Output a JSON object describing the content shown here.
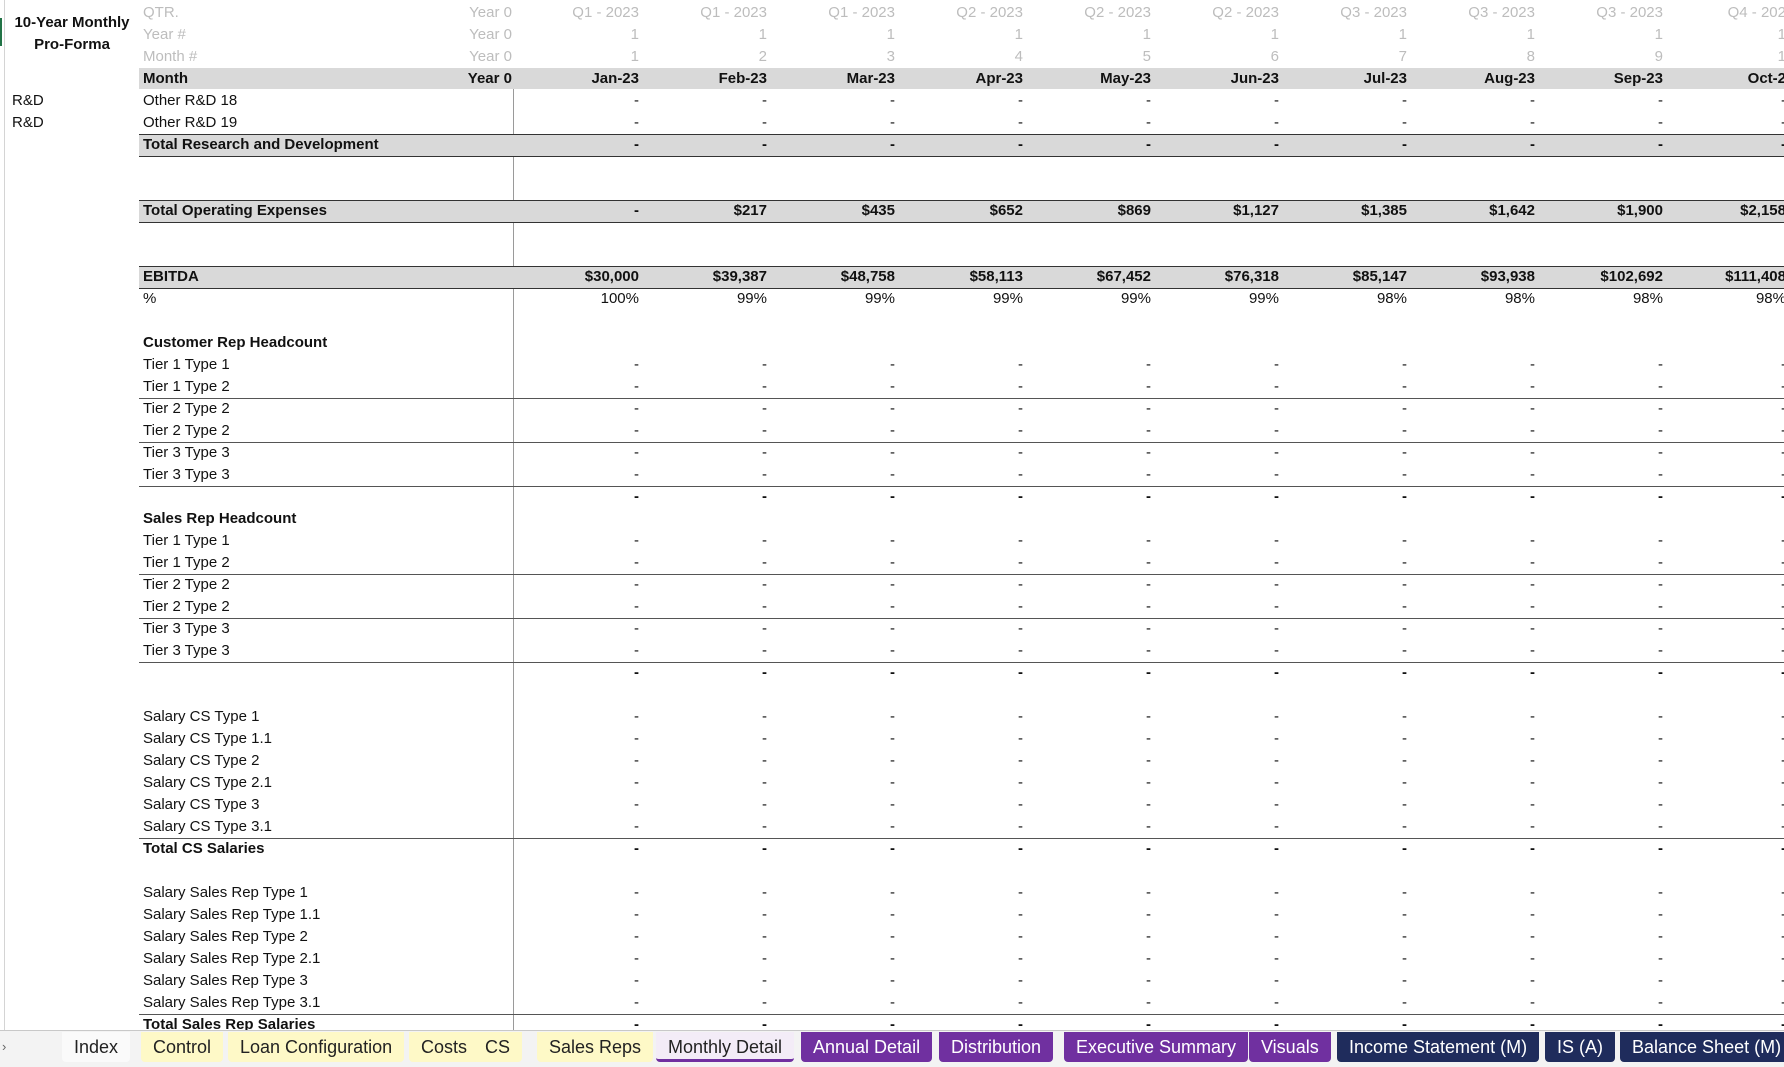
{
  "title_block": [
    "10-Year Monthly",
    "Pro-Forma"
  ],
  "header_rows": [
    {
      "label": "QTR.",
      "year0": "Year 0",
      "values": [
        "Q1 - 2023",
        "Q1 - 2023",
        "Q1 - 2023",
        "Q2 - 2023",
        "Q2 - 2023",
        "Q2 - 2023",
        "Q3 - 2023",
        "Q3 - 2023",
        "Q3 - 2023",
        "Q4 - 202"
      ]
    },
    {
      "label": "Year #",
      "year0": "Year 0",
      "values": [
        "1",
        "1",
        "1",
        "1",
        "1",
        "1",
        "1",
        "1",
        "1",
        "1"
      ]
    },
    {
      "label": "Month #",
      "year0": "Year 0",
      "values": [
        "1",
        "2",
        "3",
        "4",
        "5",
        "6",
        "7",
        "8",
        "9",
        "1"
      ]
    }
  ],
  "month_row": {
    "label": "Month",
    "year0": "Year 0",
    "values": [
      "Jan-23",
      "Feb-23",
      "Mar-23",
      "Apr-23",
      "May-23",
      "Jun-23",
      "Jul-23",
      "Aug-23",
      "Sep-23",
      "Oct-2"
    ]
  },
  "dash": "-",
  "rows": {
    "rd18": {
      "seg": "R&D",
      "label": "Other R&D 18"
    },
    "rd19": {
      "seg": "R&D",
      "label": "Other R&D 19"
    },
    "total_rd": {
      "label": "Total Research and Development"
    },
    "total_opex": {
      "label": "Total Operating Expenses",
      "values": [
        "-",
        "$217",
        "$435",
        "$652",
        "$869",
        "$1,127",
        "$1,385",
        "$1,642",
        "$1,900",
        "$2,158"
      ]
    },
    "ebitda": {
      "label": "EBITDA",
      "values": [
        "$30,000",
        "$39,387",
        "$48,758",
        "$58,113",
        "$67,452",
        "$76,318",
        "$85,147",
        "$93,938",
        "$102,692",
        "$111,408"
      ]
    },
    "pct": {
      "label": "%",
      "values": [
        "100%",
        "99%",
        "99%",
        "99%",
        "99%",
        "99%",
        "98%",
        "98%",
        "98%",
        "98%"
      ]
    },
    "cs_head": {
      "label": "Customer Rep Headcount"
    },
    "cs_items": [
      "Tier 1 Type 1",
      "Tier 1 Type 2",
      "Tier 2 Type 2",
      "Tier 2 Type 2",
      "Tier 3 Type 3",
      "Tier 3 Type 3"
    ],
    "sales_head": {
      "label": "Sales Rep Headcount"
    },
    "sales_items": [
      "Tier 1 Type 1",
      "Tier 1 Type 2",
      "Tier 2 Type 2",
      "Tier 2 Type 2",
      "Tier 3 Type 3",
      "Tier 3 Type 3"
    ],
    "cs_salaries": [
      "Salary CS Type 1",
      "Salary CS Type 1.1",
      "Salary CS Type 2",
      "Salary CS Type 2.1",
      "Salary CS Type 3",
      "Salary CS Type 3.1"
    ],
    "total_cs_salaries": {
      "label": "Total CS Salaries"
    },
    "sales_salaries": [
      "Salary Sales Rep Type 1",
      "Salary Sales Rep Type 1.1",
      "Salary Sales Rep Type 2",
      "Salary Sales Rep Type 2.1",
      "Salary Sales Rep Type 3",
      "Salary Sales Rep Type 3.1"
    ],
    "total_sales_salaries": {
      "label": "Total Sales Rep Salaries"
    }
  },
  "tabs": [
    {
      "label": "Index",
      "style": "plain"
    },
    {
      "label": "Control",
      "style": "yellow"
    },
    {
      "label": "Loan Configuration",
      "style": "yellow"
    },
    {
      "label": "Costs",
      "style": "yellow"
    },
    {
      "label": "CS",
      "style": "yellow"
    },
    {
      "label": "Sales Reps",
      "style": "yellow"
    },
    {
      "label": "Monthly Detail",
      "style": "active"
    },
    {
      "label": "Annual Detail",
      "style": "purple"
    },
    {
      "label": "Distribution",
      "style": "purple"
    },
    {
      "label": "Executive Summary",
      "style": "purple"
    },
    {
      "label": "Visuals",
      "style": "purple"
    },
    {
      "label": "Income Statement (M)",
      "style": "navy"
    },
    {
      "label": "IS (A)",
      "style": "navy"
    },
    {
      "label": "Balance Sheet (M)",
      "style": "navy"
    }
  ],
  "tab_scroll_glyph": "›"
}
